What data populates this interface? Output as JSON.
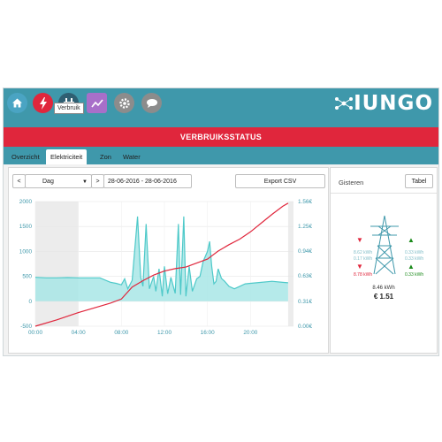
{
  "nav": {
    "icons": [
      {
        "name": "home-icon",
        "bg": "#4aa4c3"
      },
      {
        "name": "lightning-icon",
        "bg": "#e0263c"
      },
      {
        "name": "plug-icon",
        "bg": "#2f5f72"
      },
      {
        "name": "chart-icon",
        "bg": "#a86fc9"
      },
      {
        "name": "gear-icon",
        "bg": "#8c8c8c"
      },
      {
        "name": "chat-icon",
        "bg": "#8c8c8c"
      }
    ],
    "tooltip": "Verbruik"
  },
  "brand": {
    "name": "IUNGO"
  },
  "banner": {
    "title": "VERBRUIKSSTATUS"
  },
  "tabs": [
    {
      "label": "Overzicht"
    },
    {
      "label": "Elektriciteit"
    },
    {
      "label": "Zon"
    },
    {
      "label": "Water"
    }
  ],
  "controls": {
    "prev": "<",
    "period": "Dag",
    "next": ">",
    "date_range": "28-06-2016 - 28-06-2016",
    "export": "Export CSV"
  },
  "side": {
    "title": "Gisteren",
    "table_button": "Tabel",
    "left_values": [
      "8.62 kWh",
      "0.17 kWh"
    ],
    "left_total": "8.78 kWh",
    "right_values": [
      "0.33 kWh",
      "0.33 kWh"
    ],
    "right_total": "0.33 kWh",
    "net_kwh": "8.46 kWh",
    "cost": "€ 1.51"
  },
  "colors": {
    "accent": "#3f98ab",
    "danger": "#e0263c",
    "consumption": "#4ec9c9",
    "cost_line": "#e0263c"
  },
  "chart_data": {
    "type": "line",
    "x_ticks": [
      "00:00",
      "04:00",
      "08:00",
      "12:00",
      "16:00",
      "20:00"
    ],
    "y_ticks_left": [
      "2000",
      "1500",
      "1000",
      "500",
      "0",
      "-500"
    ],
    "y_ticks_right": [
      "1.56€",
      "1.25€",
      "0.94€",
      "0.63€",
      "0.31€",
      "0.00€"
    ],
    "ylim_left": [
      -500,
      2000
    ],
    "ylim_right": [
      0,
      1.56
    ],
    "xlim_hours": [
      0,
      24
    ],
    "series": [
      {
        "kind": "area",
        "x": [
          0,
          1,
          2,
          3,
          4,
          5,
          6,
          7,
          7.5,
          8,
          8.3,
          8.6,
          9,
          9.5,
          9.8,
          10,
          10.3,
          10.6,
          11,
          11.2,
          11.5,
          11.8,
          12,
          12.3,
          12.6,
          13,
          13.3,
          13.5,
          13.8,
          14,
          14.3,
          14.6,
          15,
          15.3,
          15.6,
          16,
          16.2,
          16.4,
          16.6,
          16.8,
          17,
          17.3,
          17.6,
          18,
          18.5,
          19,
          19.5,
          20,
          21,
          22,
          23,
          23.5
        ],
        "y": [
          480,
          470,
          470,
          475,
          470,
          470,
          470,
          380,
          360,
          330,
          450,
          250,
          420,
          1700,
          480,
          300,
          1550,
          250,
          500,
          200,
          650,
          100,
          700,
          150,
          480,
          160,
          1550,
          130,
          1700,
          100,
          700,
          200,
          450,
          500,
          800,
          1000,
          1200,
          700,
          350,
          400,
          650,
          460,
          400,
          300,
          250,
          300,
          350,
          360,
          380,
          400,
          380,
          370
        ]
      },
      {
        "kind": "line",
        "x": [
          0,
          2,
          4,
          6,
          7,
          8,
          9,
          10,
          11,
          12,
          13,
          14,
          15,
          16,
          17,
          18,
          19,
          20,
          21,
          22,
          23,
          23.5
        ],
        "y": [
          0.0,
          0.08,
          0.17,
          0.25,
          0.29,
          0.34,
          0.49,
          0.57,
          0.64,
          0.69,
          0.72,
          0.74,
          0.79,
          0.84,
          0.94,
          1.02,
          1.09,
          1.18,
          1.29,
          1.4,
          1.5,
          1.54
        ]
      }
    ],
    "shaded_ranges_hours": [
      [
        0,
        4
      ],
      [
        23.5,
        24
      ]
    ]
  }
}
